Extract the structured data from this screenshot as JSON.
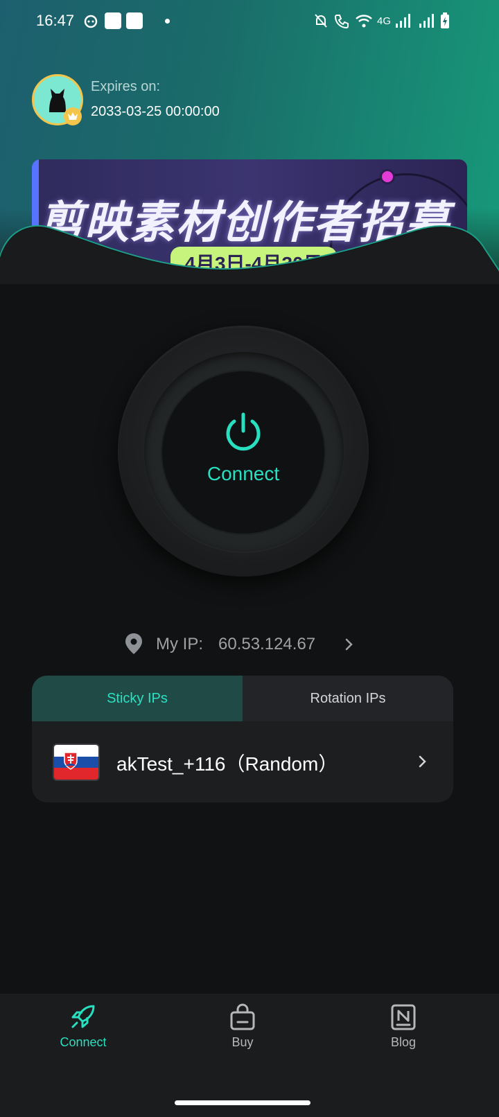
{
  "status_bar": {
    "time": "16:47",
    "network": "4G",
    "icons": [
      "cat-icon",
      "shopping-bag-icon",
      "shopping-bag-icon",
      "notification-dot-icon",
      "muted-bell-icon",
      "volte-call-icon",
      "wifi-icon",
      "signal-icon",
      "signal-icon",
      "battery-charging-icon"
    ]
  },
  "account": {
    "expires_label": "Expires on:",
    "expires_date": "2033-03-25 00:00:00",
    "avatar_icon": "cat-avatar-icon",
    "badge_icon": "crown-icon"
  },
  "banner": {
    "headline": "剪映素材创作者招募",
    "date_pill": "4月3日-4月30日"
  },
  "connect": {
    "label": "Connect",
    "icon": "power-icon"
  },
  "my_ip": {
    "label": "My IP:",
    "value": "60.53.124.67"
  },
  "ip_card": {
    "tabs": [
      {
        "label": "Sticky IPs",
        "active": true
      },
      {
        "label": "Rotation IPs",
        "active": false
      }
    ],
    "selected": {
      "flag": "slovakia-flag-icon",
      "label": "akTest_+116（Random）"
    }
  },
  "bottom_nav": {
    "items": [
      {
        "label": "Connect",
        "icon": "rocket-icon",
        "active": true
      },
      {
        "label": "Buy",
        "icon": "shopping-bag-icon",
        "active": false
      },
      {
        "label": "Blog",
        "icon": "blog-icon",
        "active": false
      }
    ]
  },
  "colors": {
    "accent": "#28e0c0",
    "background": "#111213",
    "card": "#1d1e20",
    "avatar_ring": "#f3c54a"
  }
}
